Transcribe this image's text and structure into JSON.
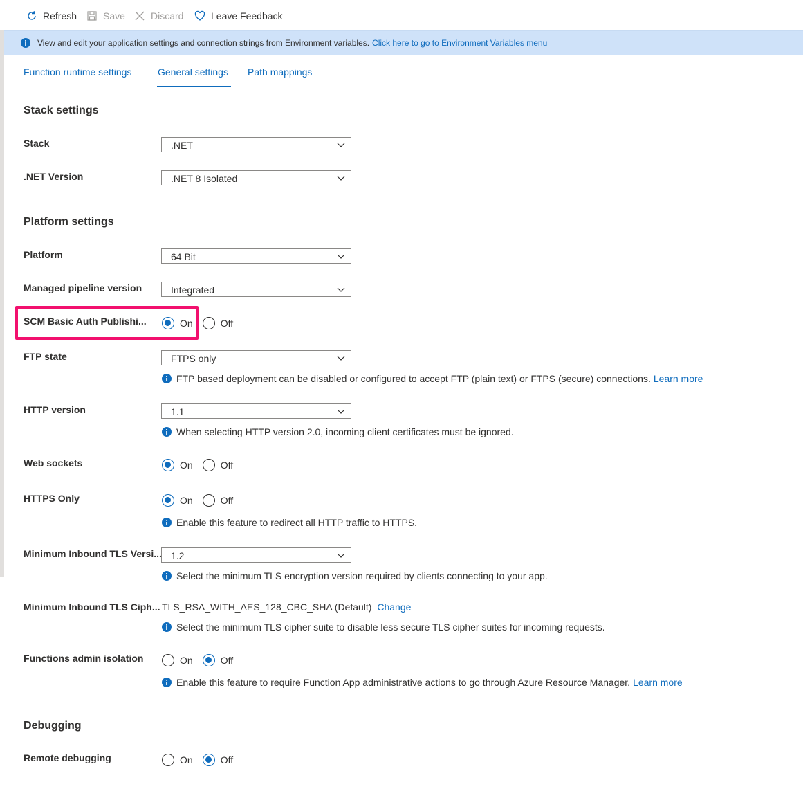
{
  "toolbar": {
    "refresh_label": "Refresh",
    "save_label": "Save",
    "discard_label": "Discard",
    "feedback_label": "Leave Feedback"
  },
  "banner": {
    "text": "View and edit your application settings and connection strings from Environment variables.",
    "link": "Click here to go to Environment Variables menu"
  },
  "tabs": [
    {
      "label": "Function runtime settings",
      "selected": false
    },
    {
      "label": "General settings",
      "selected": true
    },
    {
      "label": "Path mappings",
      "selected": false
    }
  ],
  "stack_settings": {
    "title": "Stack settings",
    "stack": {
      "label": "Stack",
      "value": ".NET"
    },
    "net_version": {
      "label": ".NET Version",
      "value": ".NET 8 Isolated"
    }
  },
  "platform_settings": {
    "title": "Platform settings",
    "platform": {
      "label": "Platform",
      "value": "64 Bit"
    },
    "pipeline": {
      "label": "Managed pipeline version",
      "value": "Integrated"
    },
    "scm_basic_auth": {
      "label": "SCM Basic Auth Publishi...",
      "on": "On",
      "off": "Off",
      "selected": "On"
    },
    "ftp_state": {
      "label": "FTP state",
      "value": "FTPS only",
      "info": "FTP based deployment can be disabled or configured to accept FTP (plain text) or FTPS (secure) connections.",
      "link": "Learn more"
    },
    "http_version": {
      "label": "HTTP version",
      "value": "1.1",
      "info": "When selecting HTTP version 2.0, incoming client certificates must be ignored."
    },
    "web_sockets": {
      "label": "Web sockets",
      "on": "On",
      "off": "Off",
      "selected": "On"
    },
    "https_only": {
      "label": "HTTPS Only",
      "on": "On",
      "off": "Off",
      "selected": "On",
      "info": "Enable this feature to redirect all HTTP traffic to HTTPS."
    },
    "min_tls": {
      "label": "Minimum Inbound TLS Versi...",
      "value": "1.2",
      "info": "Select the minimum TLS encryption version required by clients connecting to your app."
    },
    "min_tls_cipher": {
      "label": "Minimum Inbound TLS Ciph...",
      "value": "TLS_RSA_WITH_AES_128_CBC_SHA (Default)",
      "link": "Change",
      "info": "Select the minimum TLS cipher suite to disable less secure TLS cipher suites for incoming requests."
    },
    "functions_admin_isolation": {
      "label": "Functions admin isolation",
      "on": "On",
      "off": "Off",
      "selected": "Off",
      "info": "Enable this feature to require Function App administrative actions to go through Azure Resource Manager.",
      "link": "Learn more"
    }
  },
  "debugging": {
    "title": "Debugging",
    "remote_debugging": {
      "label": "Remote debugging",
      "on": "On",
      "off": "Off",
      "selected": "Off"
    }
  },
  "colors": {
    "accent": "#0f6cbd",
    "highlight": "#f2106e",
    "banner": "#cfe2f9"
  }
}
